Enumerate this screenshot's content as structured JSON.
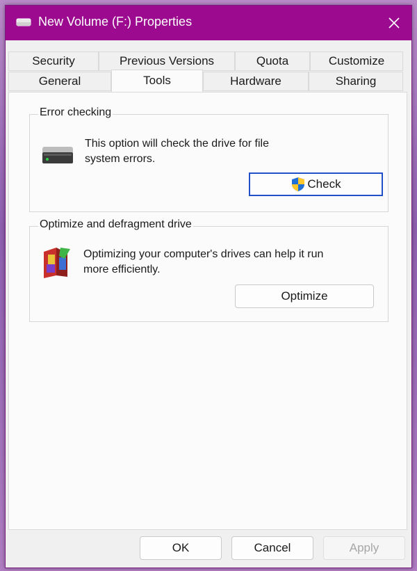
{
  "window": {
    "title": "New Volume (F:) Properties",
    "accent": "#9b0a8f"
  },
  "tabs": {
    "row1": [
      "Security",
      "Previous Versions",
      "Quota",
      "Customize"
    ],
    "row2": [
      "General",
      "Tools",
      "Hardware",
      "Sharing"
    ],
    "active": "Tools"
  },
  "error_checking": {
    "label": "Error checking",
    "description_line1": "This option will check the drive for file",
    "description_line2": "system errors.",
    "button": "Check"
  },
  "optimize": {
    "label": "Optimize and defragment drive",
    "description_line1": "Optimizing your computer's drives can help it run",
    "description_line2": "more efficiently.",
    "button": "Optimize"
  },
  "footer": {
    "ok": "OK",
    "cancel": "Cancel",
    "apply": "Apply"
  }
}
